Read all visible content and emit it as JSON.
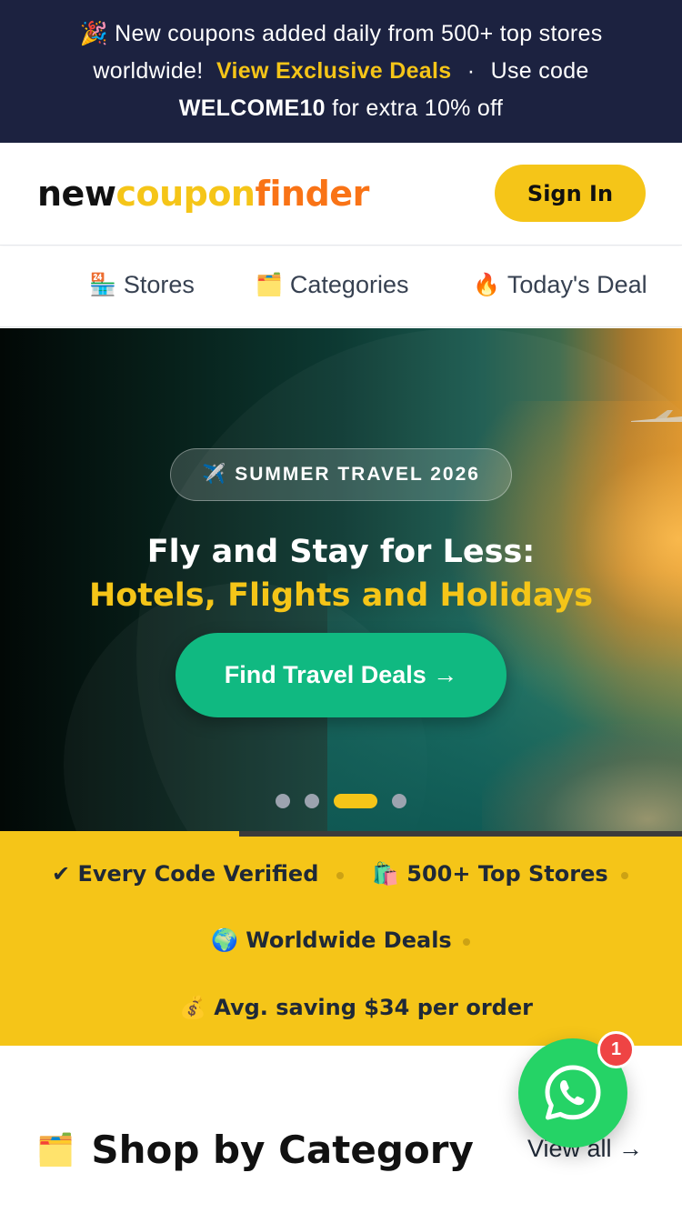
{
  "announcement": {
    "icon": "party-popper-icon",
    "icon_glyph": "🎉",
    "line1": "New coupons added daily from 500+ top stores",
    "line2_prefix": "worldwide!",
    "link_label": "View Exclusive Deals",
    "separator": "·",
    "line2_suffix": "Use code",
    "code": "WELCOME10",
    "code_suffix": "for extra 10% off"
  },
  "header": {
    "logo": {
      "part1": "new",
      "part2": "coupon",
      "part3": "finder"
    },
    "signin_label": "Sign In"
  },
  "nav": {
    "items": [
      {
        "icon_glyph": "🏪",
        "icon": "store-icon",
        "label": "Stores"
      },
      {
        "icon_glyph": "🗂️",
        "icon": "categories-icon",
        "label": "Categories"
      },
      {
        "icon_glyph": "🔥",
        "icon": "fire-icon",
        "label": "Today's Deals"
      }
    ]
  },
  "hero": {
    "badge_icon": "airplane-icon",
    "badge_glyph": "✈️",
    "badge_label": "SUMMER TRAVEL 2026",
    "title_line1": "Fly and Stay for Less:",
    "title_line2": "Hotels, Flights and Holidays",
    "cta_label": "Find Travel Deals →",
    "slides_total": 4,
    "active_slide": 3,
    "autoplay_progress": 0.35
  },
  "trust": {
    "items": [
      {
        "glyph": "✔",
        "icon": "check-icon",
        "label": "Every Code Verified"
      },
      {
        "glyph": "🛍️",
        "icon": "shopping-bags-icon",
        "label": "500+ Top Stores"
      },
      {
        "glyph": "🌍",
        "icon": "globe-icon",
        "label": "Worldwide Deals"
      },
      {
        "glyph": "💰",
        "icon": "money-bag-icon",
        "label": "Avg. saving $34 per order"
      }
    ]
  },
  "category_section": {
    "icon_glyph": "🗂️",
    "icon": "card-index-icon",
    "title": "Shop by Category",
    "view_all_label": "View all →"
  },
  "whatsapp": {
    "icon": "whatsapp-icon",
    "badge_count": "1"
  },
  "colors": {
    "announce_bg": "#1c2240",
    "accent_yellow": "#f5c518",
    "accent_orange": "#f97316",
    "cta_green": "#10b981",
    "whatsapp_green": "#25d366",
    "badge_red": "#ef4444"
  }
}
